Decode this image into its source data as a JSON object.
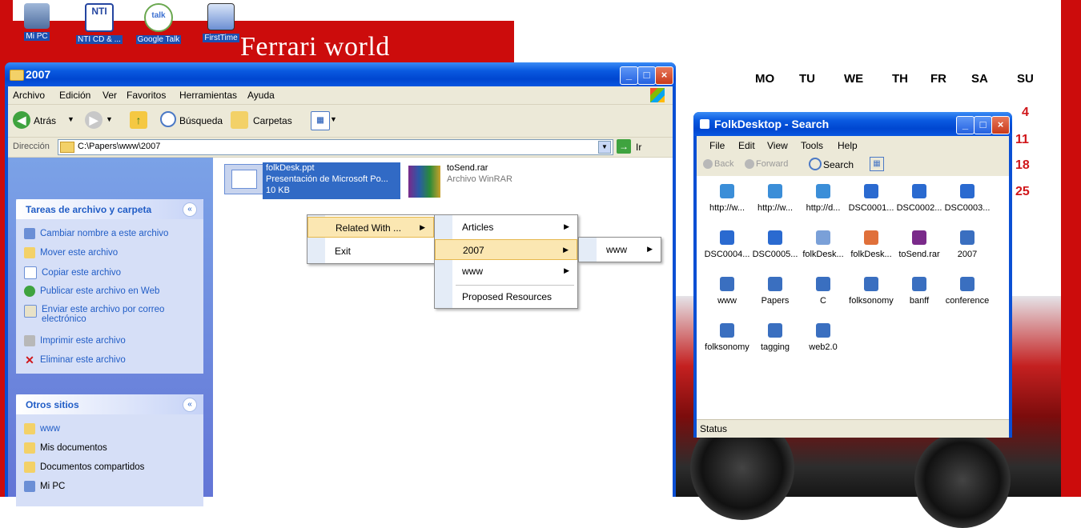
{
  "desktop": {
    "banner_title": "Ferrari world",
    "icons": [
      {
        "label": "Mi PC",
        "icon": "computer-icon"
      },
      {
        "label": "NTI CD & ...",
        "icon": "nti-icon"
      },
      {
        "label": "Google Talk",
        "icon": "google-talk-icon"
      },
      {
        "label": "FirstTime",
        "icon": "firsttime-icon"
      }
    ]
  },
  "calendar": {
    "days": [
      "MO",
      "TU",
      "WE",
      "TH",
      "FR",
      "SA",
      "SU"
    ],
    "sundays": [
      "4",
      "11",
      "18",
      "25"
    ]
  },
  "explorer": {
    "title": "2007",
    "menu": [
      "Archivo",
      "Edición",
      "Ver",
      "Favoritos",
      "Herramientas",
      "Ayuda"
    ],
    "toolbar": {
      "back": "Atrás",
      "search": "Búsqueda",
      "folders": "Carpetas"
    },
    "address": {
      "label": "Dirección",
      "value": "C:\\Papers\\www\\2007",
      "go": "Ir"
    },
    "tasks": {
      "header": "Tareas de archivo y carpeta",
      "items": [
        "Cambiar nombre a este archivo",
        "Mover este archivo",
        "Copiar este archivo",
        "Publicar este archivo en Web",
        "Enviar este archivo por correo electrónico",
        "Imprimir este archivo",
        "Eliminar este archivo"
      ]
    },
    "other_places": {
      "header": "Otros sitios",
      "items": [
        "www",
        "Mis documentos",
        "Documentos compartidos",
        "Mi PC"
      ]
    },
    "files": [
      {
        "name": "folkDesk.ppt",
        "type": "Presentación de Microsoft Po...",
        "size": "10 KB"
      },
      {
        "name": "toSend.rar",
        "type": "Archivo WinRAR",
        "size": ""
      }
    ]
  },
  "context_menu": {
    "main": [
      "Related With ...",
      "Exit"
    ],
    "related": [
      "Articles",
      "2007",
      "www",
      "Proposed Resources"
    ],
    "year": [
      "www"
    ]
  },
  "folk": {
    "title": "FolkDesktop - Search",
    "menu": [
      "File",
      "Edit",
      "View",
      "Tools",
      "Help"
    ],
    "toolbar": {
      "back": "Back",
      "forward": "Forward",
      "search": "Search"
    },
    "items": [
      {
        "label": "http://w...",
        "icon": "ie-icon"
      },
      {
        "label": "http://w...",
        "icon": "ie-icon"
      },
      {
        "label": "http://d...",
        "icon": "ie-icon"
      },
      {
        "label": "DSC0001...",
        "icon": "image-icon"
      },
      {
        "label": "DSC0002...",
        "icon": "image-icon"
      },
      {
        "label": "DSC0003...",
        "icon": "image-icon"
      },
      {
        "label": "DSC0004...",
        "icon": "image-icon"
      },
      {
        "label": "DSC0005...",
        "icon": "image-icon"
      },
      {
        "label": "folkDesk...",
        "icon": "doc-icon"
      },
      {
        "label": "folkDesk...",
        "icon": "ppt-icon"
      },
      {
        "label": "toSend.rar",
        "icon": "rar-icon"
      },
      {
        "label": "2007",
        "icon": "tag-icon"
      },
      {
        "label": "www",
        "icon": "tag-icon"
      },
      {
        "label": "Papers",
        "icon": "tag-icon"
      },
      {
        "label": "C",
        "icon": "tag-icon"
      },
      {
        "label": "folksonomy",
        "icon": "tag-icon"
      },
      {
        "label": "banff",
        "icon": "tag-icon"
      },
      {
        "label": "conference",
        "icon": "tag-icon"
      },
      {
        "label": "folksonomy",
        "icon": "tag-icon"
      },
      {
        "label": "tagging",
        "icon": "tag-icon"
      },
      {
        "label": "web2.0",
        "icon": "tag-icon"
      }
    ],
    "status": "Status"
  },
  "colors": {
    "xp_blue": "#0a4fd4",
    "ferrari_red": "#cc0c0c",
    "link_blue": "#215dc6"
  }
}
